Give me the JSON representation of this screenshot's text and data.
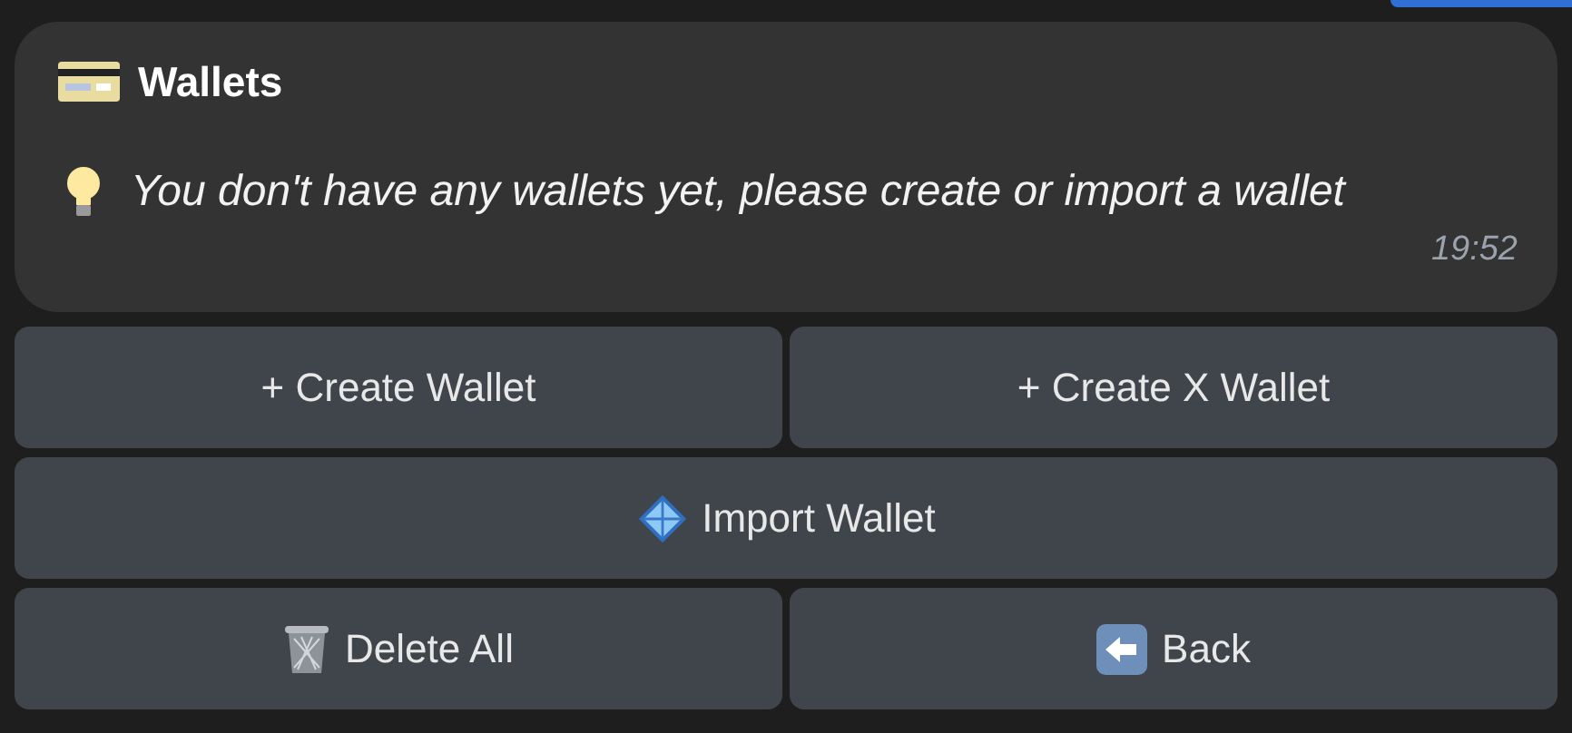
{
  "message": {
    "title": "Wallets",
    "text": "You don't have any wallets yet, please create or import a wallet",
    "time": "19:52"
  },
  "keyboard": [
    [
      {
        "label": "+ Create Wallet",
        "kind": "plain"
      },
      {
        "label": "+ Create X Wallet",
        "kind": "plain"
      }
    ],
    [
      {
        "label": "Import Wallet",
        "kind": "import"
      }
    ],
    [
      {
        "label": "Delete All",
        "kind": "delete"
      },
      {
        "label": "Back",
        "kind": "back"
      }
    ]
  ]
}
